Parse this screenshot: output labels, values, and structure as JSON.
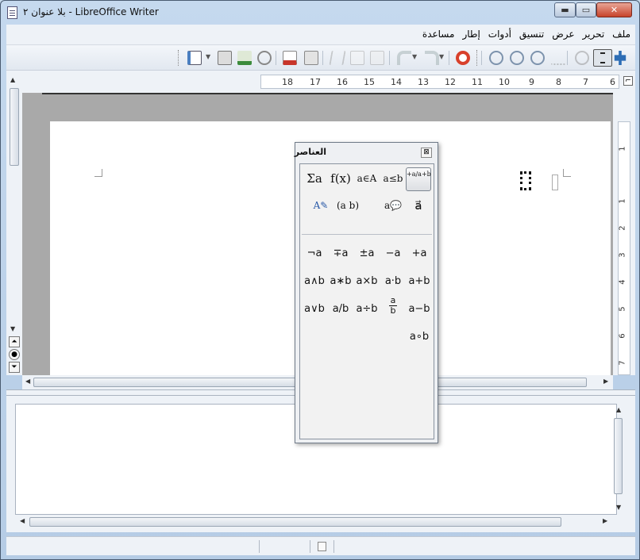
{
  "window": {
    "title": "بلا عنوان ٢ - LibreOffice Writer",
    "minimize_glyph": "▬",
    "maximize_glyph": "▭",
    "close_glyph": "✕"
  },
  "menu": {
    "items": [
      "ملف",
      "تحرير",
      "عرض",
      "تنسيق",
      "أدوات",
      "إطار",
      "مساعدة"
    ]
  },
  "toolbar": {
    "icons": [
      "formula-cursor-icon",
      "selection-cursor-icon",
      "refresh-icon",
      "zoom-all-icon",
      "zoom-100-icon",
      "zoom-out-icon",
      "zoom-in-icon",
      "help-icon",
      "redo-icon",
      "undo-icon",
      "paste-icon",
      "copy-icon",
      "cut-icon",
      "print-icon",
      "export-pdf-icon",
      "email-icon",
      "save-icon",
      "open-icon",
      "new-icon"
    ]
  },
  "ruler": {
    "numbers": [
      "18",
      "17",
      "16",
      "15",
      "14",
      "13",
      "12",
      "11",
      "10",
      "9",
      "8",
      "7",
      "6"
    ],
    "vertical_numbers": [
      "1",
      "1",
      "2",
      "3",
      "4",
      "5",
      "6",
      "7"
    ]
  },
  "elements_panel": {
    "title": "العناصر",
    "close_glyph": "⊠",
    "categories": [
      {
        "label": "+a/a+b",
        "selected": true
      },
      {
        "label": "a≤b",
        "selected": false
      },
      {
        "label": "a∈A",
        "selected": false
      },
      {
        "label": "f(x)",
        "selected": false
      },
      {
        "label": "Σa",
        "selected": false
      },
      {
        "label": "a⃗",
        "selected": false
      },
      {
        "label": "a💬",
        "selected": false
      },
      {
        "label": "(a b)",
        "selected": false
      },
      {
        "label": "A✎",
        "selected": false
      }
    ],
    "operators": {
      "row1": [
        "+a",
        "−a",
        "±a",
        "∓a",
        "¬a"
      ],
      "row2": [
        "a+b",
        "a·b",
        "a×b",
        "a∗b",
        "a∧b"
      ],
      "row3": [
        "a−b",
        "a/b (fraction)",
        "a÷b",
        "a/b",
        "a∨b"
      ],
      "row4": [
        "a∘b"
      ]
    }
  }
}
